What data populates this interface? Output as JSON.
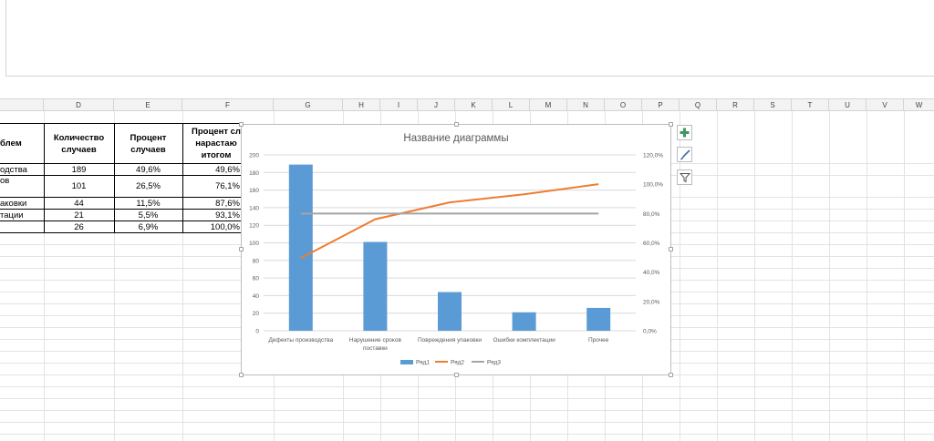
{
  "columns": [
    "D",
    "E",
    "F",
    "G",
    "H",
    "I",
    "J",
    "K",
    "L",
    "M",
    "N",
    "O",
    "P",
    "Q",
    "R",
    "S",
    "T",
    "U",
    "V",
    "W"
  ],
  "table": {
    "headers": {
      "col_c": "блем",
      "col_d": "Количество случаев",
      "col_e": "Процент случаев",
      "col_f": "Процент сл нарастаю итогом"
    },
    "rows": [
      {
        "c": "одства",
        "d": "189",
        "e": "49,6%",
        "f": "49,6%"
      },
      {
        "c": "ов",
        "d": "101",
        "e": "26,5%",
        "f": "76,1%"
      },
      {
        "c": "аковки",
        "d": "44",
        "e": "11,5%",
        "f": "87,6%"
      },
      {
        "c": "тации",
        "d": "21",
        "e": "5,5%",
        "f": "93,1%"
      },
      {
        "c": "",
        "d": "26",
        "e": "6,9%",
        "f": "100,0%"
      }
    ]
  },
  "chart_data": {
    "type": "bar",
    "title": "Название диаграммы",
    "categories": [
      "Дефекты производства",
      "Нарушение сроков поставки",
      "Повреждения упаковки",
      "Ошибки комплектации",
      "Прочее"
    ],
    "series": [
      {
        "name": "Ряд1",
        "kind": "bar",
        "axis": "left",
        "color": "#5b9bd5",
        "values": [
          189,
          101,
          44,
          21,
          26
        ]
      },
      {
        "name": "Ряд2",
        "kind": "line",
        "axis": "right",
        "color": "#ed7d31",
        "values": [
          0.496,
          0.761,
          0.876,
          0.931,
          1.0
        ]
      },
      {
        "name": "Ряд3",
        "kind": "line",
        "axis": "right",
        "color": "#a5a5a5",
        "values": [
          0.8,
          0.8,
          0.8,
          0.8,
          0.8
        ]
      }
    ],
    "ylim_left": [
      0,
      200
    ],
    "left_ticks": [
      "0",
      "20",
      "40",
      "60",
      "80",
      "100",
      "120",
      "140",
      "160",
      "180",
      "200"
    ],
    "ylim_right": [
      0,
      1.2
    ],
    "right_ticks": [
      "0,0%",
      "20,0%",
      "40,0%",
      "60,0%",
      "80,0%",
      "100,0%",
      "120,0%"
    ],
    "grid": true,
    "legend": "bottom"
  },
  "side_buttons": {
    "add_elements_icon": "plus-icon",
    "styles_icon": "brush-icon",
    "filter_icon": "filter-icon",
    "accent_green": "#3c9a5f",
    "accent_blue": "#3b6ea8"
  }
}
